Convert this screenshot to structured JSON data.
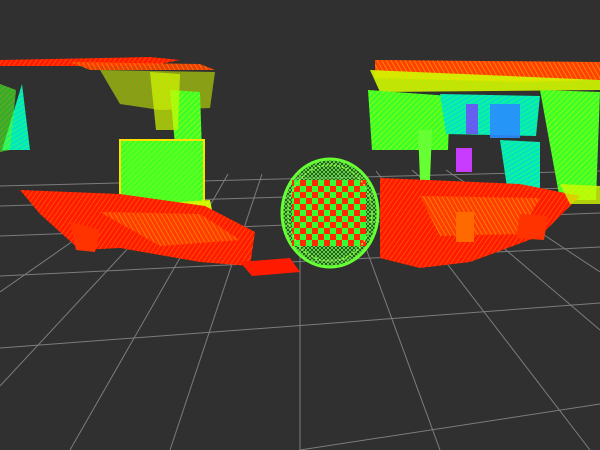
{
  "viewport": {
    "background_color": "#303030",
    "grid_color": "#8a8a8a",
    "point_colormap": [
      "#ff0000",
      "#ff6a00",
      "#ffd000",
      "#b8ff00",
      "#33ff33",
      "#00ffb0",
      "#00c8ff",
      "#6a3cff",
      "#ff00ff"
    ],
    "checkerboard_colors": [
      "#ff2a00",
      "#33ff33"
    ]
  }
}
